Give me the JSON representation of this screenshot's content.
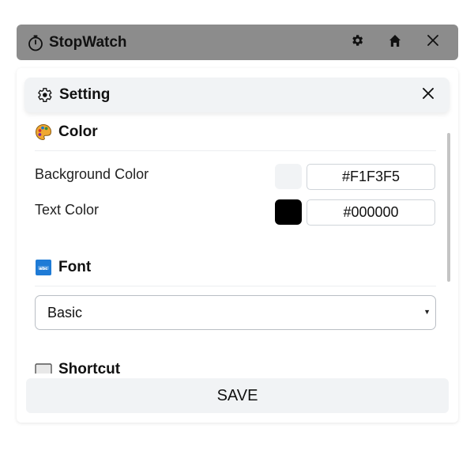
{
  "app": {
    "title": "StopWatch"
  },
  "titlebar_buttons": {
    "settings_icon": "gear-icon",
    "home_icon": "home-icon",
    "close_icon": "close-icon"
  },
  "modal": {
    "title": "Setting",
    "close_icon": "close-icon"
  },
  "sections": {
    "color": {
      "heading": "Color",
      "icon": "palette-icon",
      "background": {
        "label": "Background Color",
        "value": "#F1F3F5",
        "swatch_color": "#F1F3F5"
      },
      "text": {
        "label": "Text Color",
        "value": "#000000",
        "swatch_color": "#000000"
      }
    },
    "font": {
      "heading": "Font",
      "icon": "abc-icon",
      "selected": "Basic"
    },
    "shortcut": {
      "heading": "Shortcut",
      "icon": "keyboard-icon"
    }
  },
  "footer": {
    "save_label": "SAVE"
  },
  "colors": {
    "titlebar_bg": "#8C8C8C",
    "modal_header_bg": "#F1F3F5",
    "save_bg": "#F1F3F5"
  }
}
